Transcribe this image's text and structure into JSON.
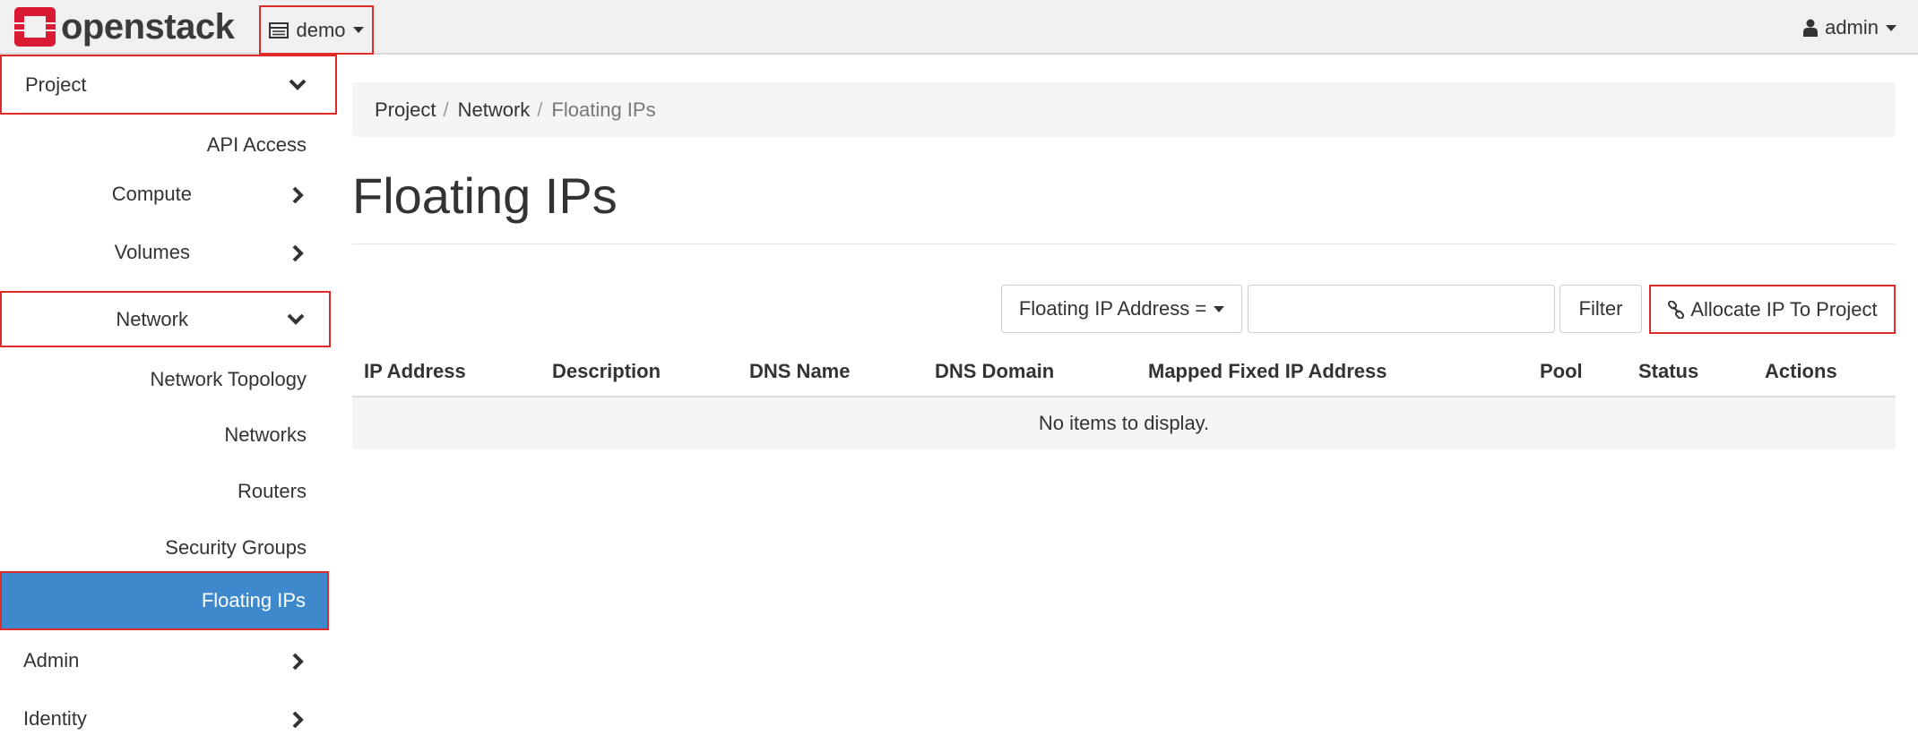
{
  "brand": {
    "name": "openstack",
    "logo_color": "#da1a32"
  },
  "navbar": {
    "project_selector": {
      "label": "demo",
      "icon": "server-icon"
    },
    "user_menu": {
      "label": "admin",
      "icon": "user-icon"
    }
  },
  "sidebar": {
    "project": {
      "label": "Project",
      "icon": "chevron-down-icon"
    },
    "api_access": "API Access",
    "compute": {
      "label": "Compute",
      "icon": "chevron-right-icon"
    },
    "volumes": {
      "label": "Volumes",
      "icon": "chevron-right-icon"
    },
    "network": {
      "label": "Network",
      "icon": "chevron-down-icon"
    },
    "network_items": [
      "Network Topology",
      "Networks",
      "Routers",
      "Security Groups",
      "Floating IPs"
    ],
    "active_item": "Floating IPs",
    "admin": {
      "label": "Admin",
      "icon": "chevron-right-icon"
    },
    "identity": {
      "label": "Identity",
      "icon": "chevron-right-icon"
    }
  },
  "breadcrumb": [
    "Project",
    "Network",
    "Floating IPs"
  ],
  "page": {
    "title": "Floating IPs"
  },
  "toolbar": {
    "filter_field": "Floating IP Address =",
    "filter_value": "",
    "filter_button": "Filter",
    "allocate_button": "Allocate IP To Project",
    "allocate_icon": "link-icon"
  },
  "table": {
    "columns": [
      "IP Address",
      "Description",
      "DNS Name",
      "DNS Domain",
      "Mapped Fixed IP Address",
      "Pool",
      "Status",
      "Actions"
    ],
    "empty_message": "No items to display."
  },
  "colors": {
    "active_bg": "#3e89cc",
    "highlight_border": "#e02b2b"
  }
}
